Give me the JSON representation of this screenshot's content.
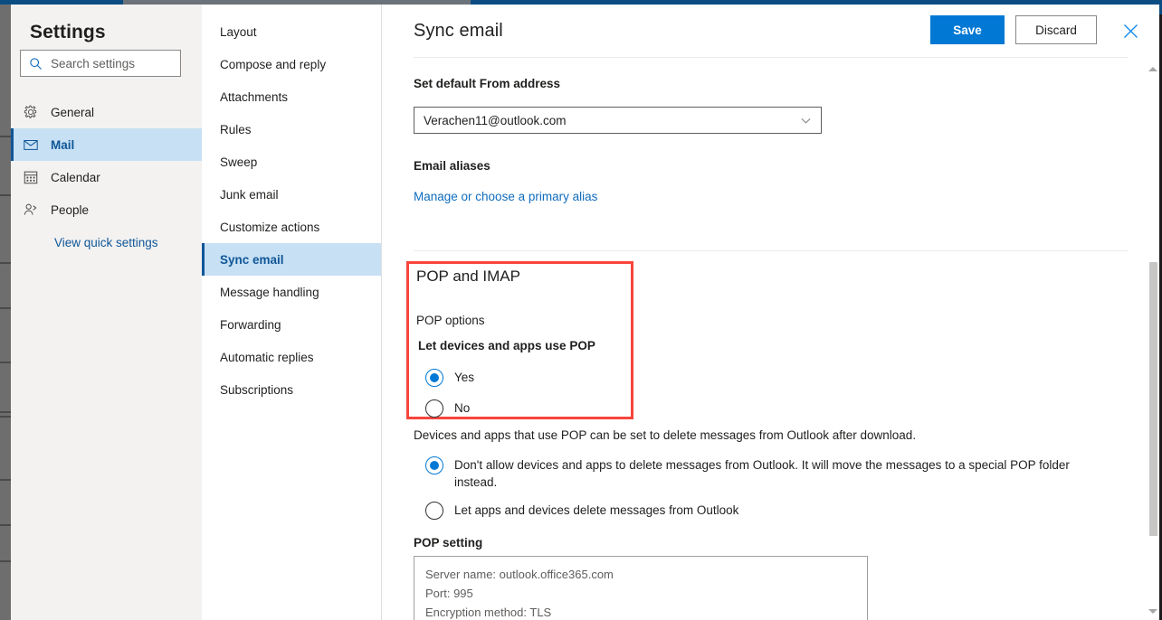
{
  "window": {
    "accent_blue": "#0078d4",
    "highlight_red": "#f8453c",
    "selected_nav_bg": "#c7e0f4"
  },
  "sidebar": {
    "title": "Settings",
    "search": {
      "placeholder": "Search settings",
      "icon": "search-icon"
    },
    "items": [
      {
        "label": "General",
        "icon": "gear-icon",
        "selected": false
      },
      {
        "label": "Mail",
        "icon": "envelope-icon",
        "selected": true
      },
      {
        "label": "Calendar",
        "icon": "calendar-icon",
        "selected": false
      },
      {
        "label": "People",
        "icon": "people-icon",
        "selected": false
      }
    ],
    "quick_settings_link": "View quick settings"
  },
  "subnav": {
    "items": [
      {
        "label": "Layout",
        "selected": false
      },
      {
        "label": "Compose and reply",
        "selected": false
      },
      {
        "label": "Attachments",
        "selected": false
      },
      {
        "label": "Rules",
        "selected": false
      },
      {
        "label": "Sweep",
        "selected": false
      },
      {
        "label": "Junk email",
        "selected": false
      },
      {
        "label": "Customize actions",
        "selected": false
      },
      {
        "label": "Sync email",
        "selected": true
      },
      {
        "label": "Message handling",
        "selected": false
      },
      {
        "label": "Forwarding",
        "selected": false
      },
      {
        "label": "Automatic replies",
        "selected": false
      },
      {
        "label": "Subscriptions",
        "selected": false
      }
    ]
  },
  "header": {
    "title": "Sync email",
    "save_label": "Save",
    "discard_label": "Discard",
    "close_icon": "close-icon"
  },
  "main": {
    "from_address": {
      "label": "Set default From address",
      "value": "Verachen11@outlook.com",
      "chevron_icon": "chevron-down-icon"
    },
    "aliases": {
      "label": "Email aliases",
      "link_text": "Manage or choose a primary alias"
    },
    "pop_imap": {
      "heading": "POP and IMAP",
      "options_label": "POP options",
      "let_devices_label": "Let devices and apps use POP",
      "radios": [
        {
          "label": "Yes",
          "checked": true
        },
        {
          "label": "No",
          "checked": false
        }
      ]
    },
    "delete_section": {
      "description": "Devices and apps that use POP can be set to delete messages from Outlook after download.",
      "radios": [
        {
          "label": "Don't allow devices and apps to delete messages from Outlook. It will move the messages to a special POP folder instead.",
          "checked": true
        },
        {
          "label": "Let apps and devices delete messages from Outlook",
          "checked": false
        }
      ]
    },
    "pop_setting": {
      "label": "POP setting",
      "lines": [
        "Server name: outlook.office365.com",
        "Port: 995",
        "Encryption method: TLS"
      ]
    }
  },
  "scrollbar": {
    "up_icon": "scroll-up-arrow-icon",
    "down_icon": "scroll-down-arrow-icon"
  }
}
